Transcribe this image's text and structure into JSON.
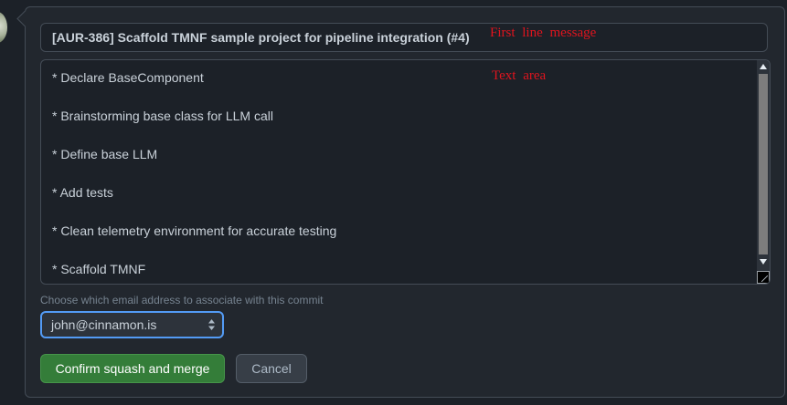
{
  "commit": {
    "title": "[AUR-386] Scaffold TMNF sample project for pipeline integration (#4)",
    "body_lines": [
      "* Declare BaseComponent",
      "* Brainstorming base class for LLM call",
      "* Define base LLM",
      "* Add tests",
      "* Clean telemetry environment for accurate testing",
      "* Scaffold TMNF"
    ]
  },
  "annotations": {
    "title_note": "First line message",
    "body_note": "Text area"
  },
  "email": {
    "label": "Choose which email address to associate with this commit",
    "selected": "john@cinnamon.is"
  },
  "actions": {
    "confirm_label": "Confirm squash and merge",
    "cancel_label": "Cancel"
  },
  "colors": {
    "primary_button": "#347d39",
    "focus_ring": "#539bf5",
    "annotation": "#e0141e"
  },
  "icons": {
    "avatar": "user-avatar",
    "select": "select-chevron-icon",
    "scroll_up": "scroll-up-arrow-icon",
    "scroll_down": "scroll-down-arrow-icon"
  }
}
